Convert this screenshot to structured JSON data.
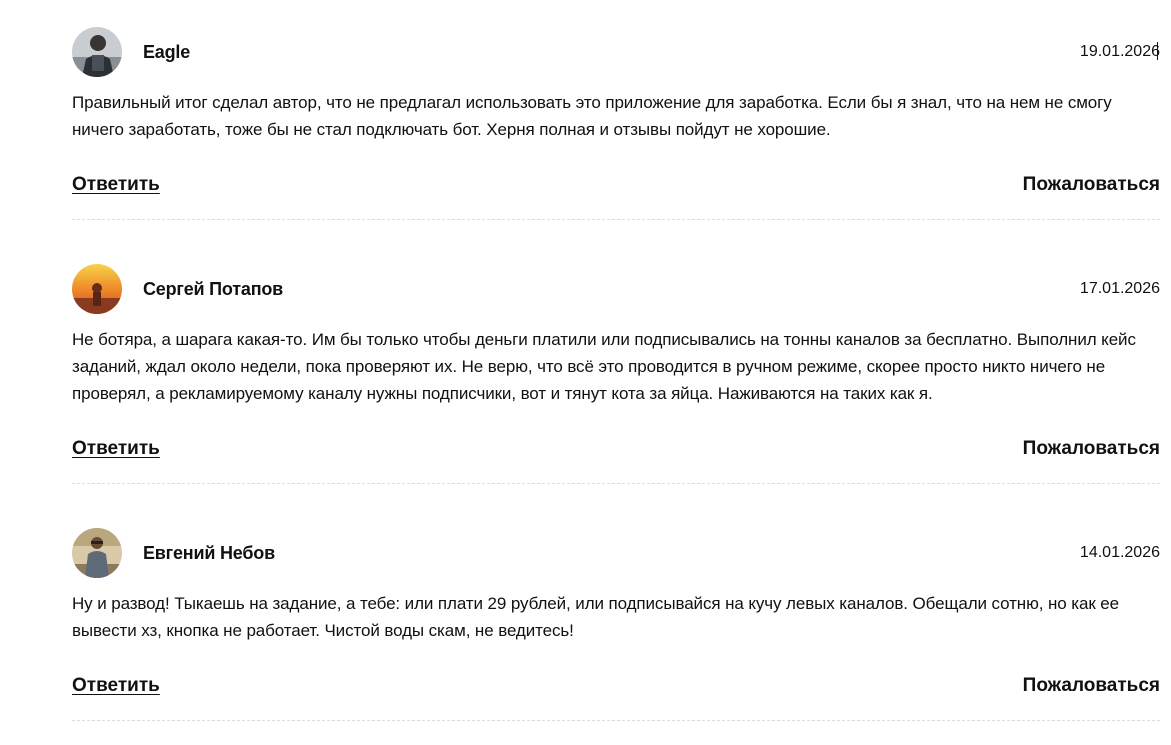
{
  "comments": [
    {
      "author": "Eagle",
      "date": "19.01.2026",
      "avatar": "user-avatar-icon",
      "text": "Правильный итог сделал автор, что не предлагал использовать это приложение для заработка. Если бы я знал, что на нем не смогу ничего заработать, тоже бы не стал подключать бот. Херня полная и отзывы пойдут не хорошие.",
      "reply_label": "Ответить",
      "report_label": "Пожаловаться"
    },
    {
      "author": "Сергей Потапов",
      "date": "17.01.2026",
      "avatar": "user-avatar-icon",
      "text": "Не ботяра, а шарага какая-то. Им бы только чтобы деньги платили или подписывались на тонны каналов за бесплатно. Выполнил кейс заданий, ждал около недели, пока проверяют их. Не верю, что всё это проводится в ручном режиме, скорее просто никто ничего не проверял, а рекламируемому каналу нужны подписчики, вот и тянут кота за яйца. Наживаются на таких как я.",
      "reply_label": "Ответить",
      "report_label": "Пожаловаться"
    },
    {
      "author": "Евгений Небов",
      "date": "14.01.2026",
      "avatar": "user-avatar-icon",
      "text": "Ну и развод! Тыкаешь на задание, а тебе: или плати 29 рублей, или подписывайся на кучу левых каналов. Обещали сотню, но как ее вывести хз, кнопка не работает. Чистой воды скам, не ведитесь!",
      "reply_label": "Ответить",
      "report_label": "Пожаловаться"
    }
  ]
}
